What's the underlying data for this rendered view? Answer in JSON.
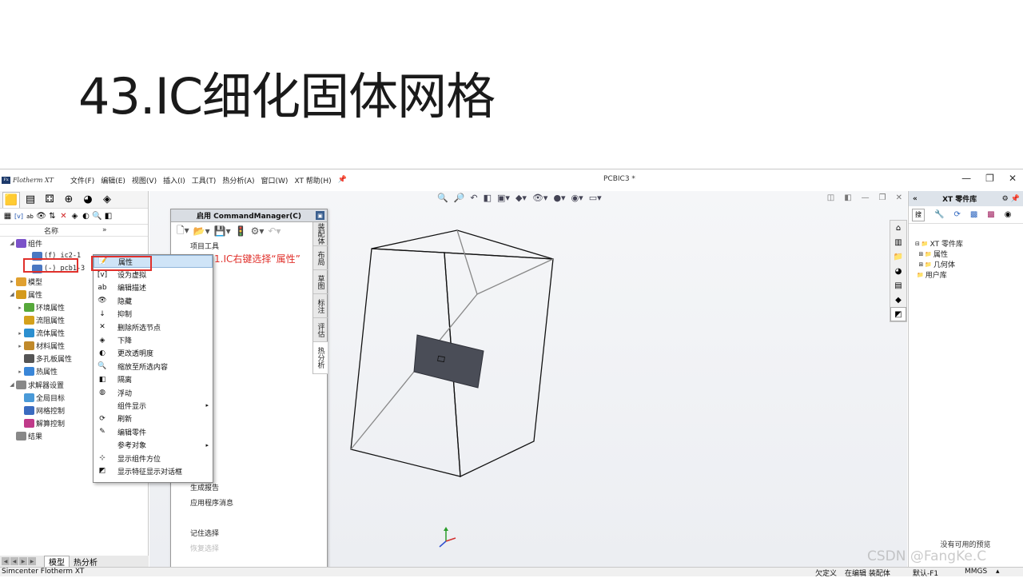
{
  "slide": {
    "title": "43.IC细化固体网格"
  },
  "app": {
    "logo_text": "Flotherm XT",
    "logo_badge": "Fx",
    "menus": [
      "文件(F)",
      "编辑(E)",
      "视图(V)",
      "插入(I)",
      "工具(T)",
      "热分析(A)",
      "窗口(W)",
      "XT 帮助(H)"
    ],
    "doc_title": "PCBIC3 *"
  },
  "tree": {
    "header_name": "名称",
    "header_more": "»",
    "rows": [
      {
        "label": "组件",
        "expander": "◢",
        "indent": 0,
        "icon": "assembly-icon",
        "color": "#7b52c9"
      },
      {
        "label": "(f) ic2-1",
        "expander": "",
        "indent": 2,
        "icon": "part-icon",
        "color": "#4a78c2",
        "mono": true
      },
      {
        "label": "(-) pcb1-3",
        "expander": "",
        "indent": 2,
        "icon": "part-icon",
        "color": "#4a78c2",
        "mono": true
      },
      {
        "label": "模型",
        "expander": "▸",
        "indent": 0,
        "icon": "model-icon",
        "color": "#e0a030"
      },
      {
        "label": "属性",
        "expander": "◢",
        "indent": 0,
        "icon": "attributes-icon",
        "color": "#d49a1c"
      },
      {
        "label": "环境属性",
        "expander": "▸",
        "indent": 1,
        "icon": "ambient-icon",
        "color": "#56a83a"
      },
      {
        "label": "流阻属性",
        "expander": "",
        "indent": 1,
        "icon": "resistance-icon",
        "color": "#d4a11c"
      },
      {
        "label": "流体属性",
        "expander": "▸",
        "indent": 1,
        "icon": "fluid-icon",
        "color": "#2b8fd0"
      },
      {
        "label": "材料属性",
        "expander": "▸",
        "indent": 1,
        "icon": "material-icon",
        "color": "#c0892a"
      },
      {
        "label": "多孔板属性",
        "expander": "",
        "indent": 1,
        "icon": "perforated-icon",
        "color": "#555555"
      },
      {
        "label": "热属性",
        "expander": "▸",
        "indent": 1,
        "icon": "thermal-icon",
        "color": "#3a86d8"
      },
      {
        "label": "求解器设置",
        "expander": "◢",
        "indent": 0,
        "icon": "solver-icon",
        "color": "#888888"
      },
      {
        "label": "全局目标",
        "expander": "",
        "indent": 1,
        "icon": "goal-icon",
        "color": "#4a9ad8"
      },
      {
        "label": "网格控制",
        "expander": "",
        "indent": 1,
        "icon": "mesh-icon",
        "color": "#3a6bc0"
      },
      {
        "label": "解算控制",
        "expander": "",
        "indent": 1,
        "icon": "solve-icon",
        "color": "#c03a8a"
      },
      {
        "label": "结果",
        "expander": "",
        "indent": 0,
        "icon": "results-icon",
        "color": "#888888"
      }
    ]
  },
  "bottom_tabs": [
    "模型",
    "热分析"
  ],
  "command_manager": {
    "title": "启用 CommandManager(C)",
    "items": [
      {
        "label": "项目工具",
        "faded": false
      },
      {
        "label": "",
        "faded": false
      },
      {
        "label": "art 库",
        "faded": false
      },
      {
        "label": "",
        "faded": false
      },
      {
        "label": "",
        "faded": false
      },
      {
        "label": "征",
        "faded": false
      },
      {
        "label": "",
        "faded": false
      },
      {
        "label": "",
        "faded": false
      },
      {
        "label": "性",
        "faded": false
      },
      {
        "label": "",
        "faded": false
      },
      {
        "label": "工具",
        "faded": false
      },
      {
        "label": "器",
        "faded": false
      },
      {
        "label": "",
        "faded": false
      },
      {
        "label": "",
        "faded": false
      },
      {
        "label": "",
        "faded": false
      },
      {
        "label": "",
        "faded": false
      },
      {
        "label": "",
        "faded": false
      },
      {
        "label": "",
        "faded": true
      },
      {
        "label": "粒子",
        "faded": true
      },
      {
        "label": "",
        "faded": true
      },
      {
        "label": "生成报告",
        "faded": false
      },
      {
        "label": "应用程序消息",
        "faded": false
      },
      {
        "label": "",
        "faded": false
      },
      {
        "label": "记住选择",
        "faded": false
      },
      {
        "label": "恢复选择",
        "faded": true
      }
    ],
    "vtabs": [
      "装配体",
      "布局",
      "草图",
      "标注",
      "评估",
      "热分析"
    ]
  },
  "context_menu": {
    "items": [
      {
        "label": "属性",
        "icon": "properties-icon",
        "glyph": "📝",
        "selected": true,
        "submenu": false
      },
      {
        "label": "设为虚拟",
        "icon": "virtual-icon",
        "glyph": "[v]",
        "selected": false,
        "submenu": false
      },
      {
        "label": "编辑描述",
        "icon": "description-icon",
        "glyph": "ab",
        "selected": false,
        "submenu": false
      },
      {
        "label": "隐藏",
        "icon": "hide-icon",
        "glyph": "👁",
        "selected": false,
        "submenu": false
      },
      {
        "label": "抑制",
        "icon": "suppress-icon",
        "glyph": "↓",
        "selected": false,
        "submenu": false
      },
      {
        "label": "删除所选节点",
        "icon": "delete-icon",
        "glyph": "✕",
        "selected": false,
        "submenu": false
      },
      {
        "label": "下降",
        "icon": "dissolve-icon",
        "glyph": "◈",
        "selected": false,
        "submenu": false
      },
      {
        "label": "更改透明度",
        "icon": "transparency-icon",
        "glyph": "◐",
        "selected": false,
        "submenu": false
      },
      {
        "label": "缩放至所选内容",
        "icon": "zoom-selection-icon",
        "glyph": "🔍",
        "selected": false,
        "submenu": false
      },
      {
        "label": "隔离",
        "icon": "isolate-icon",
        "glyph": "◧",
        "selected": false,
        "submenu": false
      },
      {
        "label": "浮动",
        "icon": "float-icon",
        "glyph": "◍",
        "selected": false,
        "submenu": false
      },
      {
        "label": "组件显示",
        "icon": "",
        "glyph": "",
        "selected": false,
        "submenu": true
      },
      {
        "label": "刷新",
        "icon": "refresh-icon",
        "glyph": "⟳",
        "selected": false,
        "submenu": false
      },
      {
        "label": "编辑零件",
        "icon": "edit-part-icon",
        "glyph": "✎",
        "selected": false,
        "submenu": false
      },
      {
        "label": "参考对象",
        "icon": "",
        "glyph": "",
        "selected": false,
        "submenu": true
      },
      {
        "label": "显示组件方位",
        "icon": "triad-icon",
        "glyph": "⊹",
        "selected": false,
        "submenu": false
      },
      {
        "label": "显示特征显示对话框",
        "icon": "feature-dialog-icon",
        "glyph": "◩",
        "selected": false,
        "submenu": false
      }
    ]
  },
  "annotation": {
    "text": "1.IC右键选择“属性”",
    "color": "#e0302b"
  },
  "right_panel": {
    "title": "XT 零件库",
    "collapse": "«",
    "search_label": "搜",
    "tree": [
      {
        "label": "XT 零件库",
        "prefix": "⊟"
      },
      {
        "label": "属性",
        "prefix": "  ⊞"
      },
      {
        "label": "几何体",
        "prefix": "  ⊞"
      },
      {
        "label": "用户库",
        "prefix": ""
      }
    ],
    "empty_preview": "没有可用的预览"
  },
  "status_bar": {
    "app_name": "Simcenter Flotherm XT",
    "underdefined": "欠定义",
    "editing": "在编辑 装配体",
    "config": "默认-F1",
    "units": "MMGS",
    "units_arrow": "▴"
  },
  "watermark": "CSDN @FangKe.C"
}
